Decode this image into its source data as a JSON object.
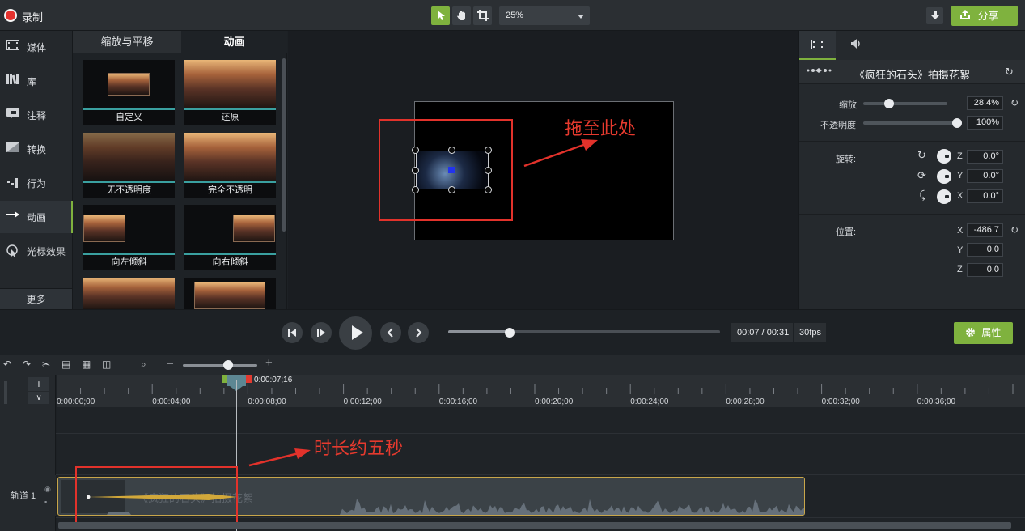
{
  "topbar": {
    "record_label": "录制",
    "zoom_value": "25%",
    "share_label": "分享"
  },
  "sidebar": {
    "items": [
      {
        "label": "媒体",
        "icon": "media-film-icon"
      },
      {
        "label": "库",
        "icon": "library-books-icon"
      },
      {
        "label": "注释",
        "icon": "annotation-callout-icon"
      },
      {
        "label": "转换",
        "icon": "transition-icon"
      },
      {
        "label": "行为",
        "icon": "behavior-icon"
      },
      {
        "label": "动画",
        "icon": "animation-arrow-icon"
      },
      {
        "label": "光标效果",
        "icon": "cursor-effect-icon"
      }
    ],
    "active": "动画",
    "more_label": "更多"
  },
  "library": {
    "tabs": [
      "缩放与平移",
      "动画"
    ],
    "active_tab": "动画",
    "presets": [
      {
        "label": "自定义"
      },
      {
        "label": "还原"
      },
      {
        "label": "无不透明度"
      },
      {
        "label": "完全不透明"
      },
      {
        "label": "向左倾斜"
      },
      {
        "label": "向右倾斜"
      },
      {
        "label": ""
      },
      {
        "label": ""
      }
    ]
  },
  "canvas": {
    "annotation_text": "拖至此处",
    "annotation_color": "#e63a2e"
  },
  "properties": {
    "title": "《疯狂的石头》拍摄花絮",
    "scale_label": "缩放",
    "scale_value": "28.4%",
    "scale_level": 0.284,
    "opacity_label": "不透明度",
    "opacity_value": "100%",
    "opacity_level": 1.0,
    "rotation_label": "旋转:",
    "rotation": [
      {
        "axis": "Z",
        "value": "0.0°"
      },
      {
        "axis": "Y",
        "value": "0.0°"
      },
      {
        "axis": "X",
        "value": "0.0°"
      }
    ],
    "position_label": "位置:",
    "position": [
      {
        "axis": "X",
        "value": "-486.7"
      },
      {
        "axis": "Y",
        "value": "0.0"
      },
      {
        "axis": "Z",
        "value": "0.0"
      }
    ]
  },
  "playback": {
    "time": "00:07 / 00:31",
    "fps": "30fps",
    "progress": 0.226,
    "properties_label": "属性"
  },
  "timeline": {
    "playhead_time": "0:00:07;16",
    "ruler_labels": [
      "0:00:00;00",
      "0:00:04;00",
      "0:00:08;00",
      "0:00:12;00",
      "0:00:16;00",
      "0:00:20;00",
      "0:00:24;00",
      "0:00:28;00",
      "0:00:32;00",
      "0:00:36;00"
    ],
    "track_label": "轨道 1",
    "clip_title": "《疯狂的石头》拍摄花絮",
    "annotation_text": "时长约五秒"
  },
  "colors": {
    "accent": "#7fb23e",
    "annotation_red": "#e2322b",
    "clip_border": "#c8a64a"
  }
}
